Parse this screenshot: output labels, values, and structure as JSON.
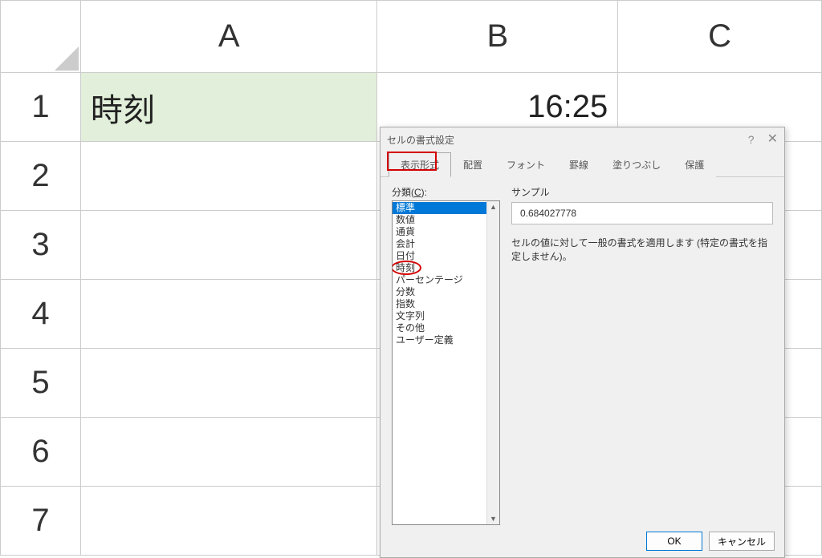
{
  "sheet": {
    "columns": [
      "A",
      "B",
      "C"
    ],
    "rows": [
      "1",
      "2",
      "3",
      "4",
      "5",
      "6",
      "7"
    ],
    "cells": {
      "A1": "時刻",
      "B1": "16:25"
    }
  },
  "dialog": {
    "title": "セルの書式設定",
    "tabs": [
      "表示形式",
      "配置",
      "フォント",
      "罫線",
      "塗りつぶし",
      "保護"
    ],
    "category_label_prefix": "分類(",
    "category_label_key": "C",
    "category_label_suffix": "):",
    "categories": [
      "標準",
      "数値",
      "通貨",
      "会計",
      "日付",
      "時刻",
      "パーセンテージ",
      "分数",
      "指数",
      "文字列",
      "その他",
      "ユーザー定義"
    ],
    "sample_label": "サンプル",
    "sample_value": "0.684027778",
    "description": "セルの値に対して一般の書式を適用します (特定の書式を指定しません)。",
    "ok": "OK",
    "cancel": "キャンセル"
  }
}
